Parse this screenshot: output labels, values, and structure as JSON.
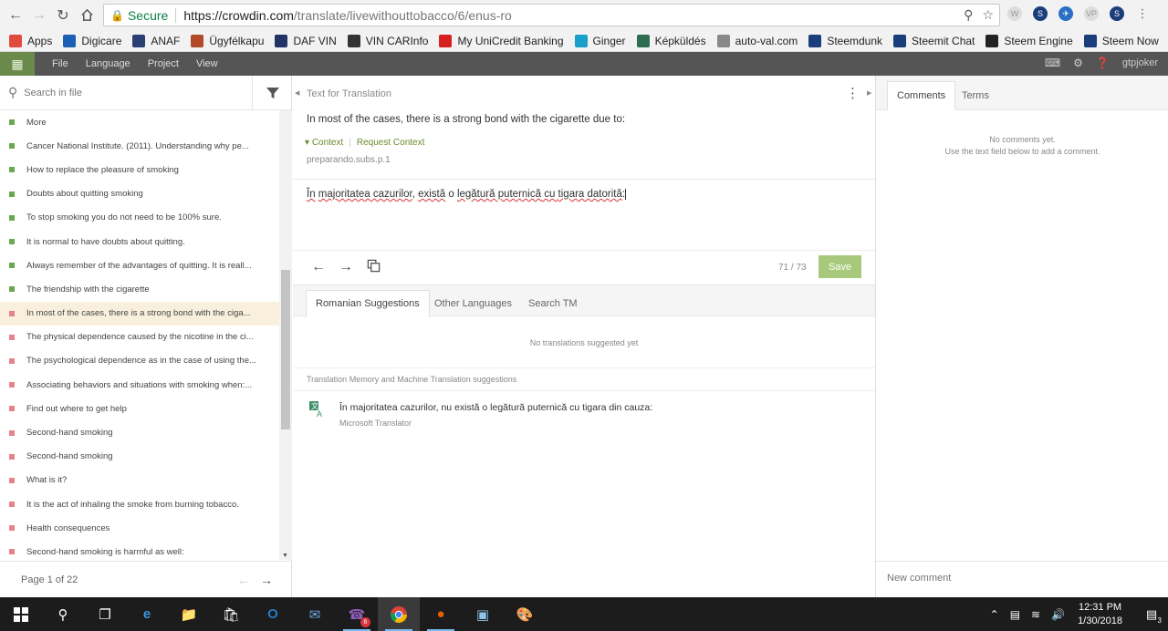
{
  "browser": {
    "secure_label": "Secure",
    "url_host": "https://crowdin.com",
    "url_path": "/translate/livewithouttobacco/6/enus-ro"
  },
  "bookmarks": [
    {
      "label": "Apps",
      "icon": "apps-grid-icon",
      "color": "#e04a3f"
    },
    {
      "label": "Digicare",
      "icon": "digicare-icon",
      "color": "#1a5fb4"
    },
    {
      "label": "ANAF",
      "icon": "anaf-shield-icon",
      "color": "#2b3f73"
    },
    {
      "label": "Ügyfélkapu",
      "icon": "ugyfelkapu-icon",
      "color": "#b24a2a"
    },
    {
      "label": "DAF VIN",
      "icon": "daf-icon",
      "color": "#223366"
    },
    {
      "label": "VIN CARInfo",
      "icon": "carinfo-icon",
      "color": "#333333"
    },
    {
      "label": "My UniCredit Banking",
      "icon": "unicredit-icon",
      "color": "#d42020"
    },
    {
      "label": "Ginger",
      "icon": "ginger-icon",
      "color": "#19a0c9"
    },
    {
      "label": "Képküldés",
      "icon": "kepkuldes-icon",
      "color": "#2c6e4f"
    },
    {
      "label": "auto-val.com",
      "icon": "page-icon",
      "color": "#888888"
    },
    {
      "label": "Steemdunk",
      "icon": "steemdunk-icon",
      "color": "#1a3d7c"
    },
    {
      "label": "Steemit Chat",
      "icon": "steemit-chat-icon",
      "color": "#1a3d7c"
    },
    {
      "label": "Steem Engine",
      "icon": "steem-engine-icon",
      "color": "#222222"
    },
    {
      "label": "Steem Now",
      "icon": "steem-now-icon",
      "color": "#1a3d7c"
    }
  ],
  "appbar": {
    "menu": [
      "File",
      "Language",
      "Project",
      "View"
    ],
    "username": "gtpjoker"
  },
  "left": {
    "search_placeholder": "Search in file",
    "strings": [
      {
        "text": "More",
        "status": "ok"
      },
      {
        "text": "Cancer National Institute. (2011). Understanding why pe...",
        "status": "ok"
      },
      {
        "text": "How to replace the pleasure of smoking",
        "status": "ok"
      },
      {
        "text": "Doubts about quitting smoking",
        "status": "ok"
      },
      {
        "text": "To stop smoking you do not need to be 100% sure.",
        "status": "ok"
      },
      {
        "text": "It is normal to have doubts about quitting.",
        "status": "ok"
      },
      {
        "text": "Always remember of the advantages of quitting. It is reall...",
        "status": "ok"
      },
      {
        "text": "The friendship with the cigarette",
        "status": "ok"
      },
      {
        "text": "In most of the cases, there is a strong bond with the ciga...",
        "status": "no",
        "active": true
      },
      {
        "text": "The physical dependence caused by the nicotine in the ci...",
        "status": "no"
      },
      {
        "text": "The psychological dependence as in the case of using the...",
        "status": "no"
      },
      {
        "text": "Associating behaviors and situations with smoking when:...",
        "status": "no"
      },
      {
        "text": "Find out where to get help",
        "status": "no"
      },
      {
        "text": "Second-hand smoking",
        "status": "no"
      },
      {
        "text": "Second-hand smoking",
        "status": "no"
      },
      {
        "text": "What is it?",
        "status": "no"
      },
      {
        "text": "It is the act of inhaling the smoke from burning tobacco.",
        "status": "no"
      },
      {
        "text": "Health consequences",
        "status": "no"
      },
      {
        "text": "Second-hand smoking is harmful as well:",
        "status": "no"
      }
    ],
    "pager": "Page 1 of 22"
  },
  "center": {
    "source_header": "Text for Translation",
    "source_text": "In most of the cases, there is a strong bond with the cigarette due to:",
    "context_label": "Context",
    "request_context_label": "Request Context",
    "string_key": "preparando.subs.p.1",
    "translation_words": [
      "În",
      " ",
      "majoritatea cazurilor",
      ", ",
      "există",
      " o ",
      "legătură puternică",
      " cu ",
      "tigara datorită",
      ":"
    ],
    "counter": "71 / 73",
    "save_label": "Save",
    "tabs": [
      "Romanian Suggestions",
      "Other Languages",
      "Search TM"
    ],
    "no_suggestions": "No translations suggested yet",
    "tm_header": "Translation Memory and Machine Translation suggestions",
    "mt_suggestion": "În majoritatea cazurilor, nu există o legătură puternică cu tigara din cauza:",
    "mt_source": "Microsoft Translator"
  },
  "right": {
    "tabs": [
      "Comments",
      "Terms"
    ],
    "no_comments_line1": "No comments yet.",
    "no_comments_line2": "Use the text field below to add a comment.",
    "comment_placeholder": "New comment"
  },
  "taskbar": {
    "time": "12:31 PM",
    "date": "1/30/2018",
    "viber_badge": "6",
    "notif_count": "3"
  }
}
